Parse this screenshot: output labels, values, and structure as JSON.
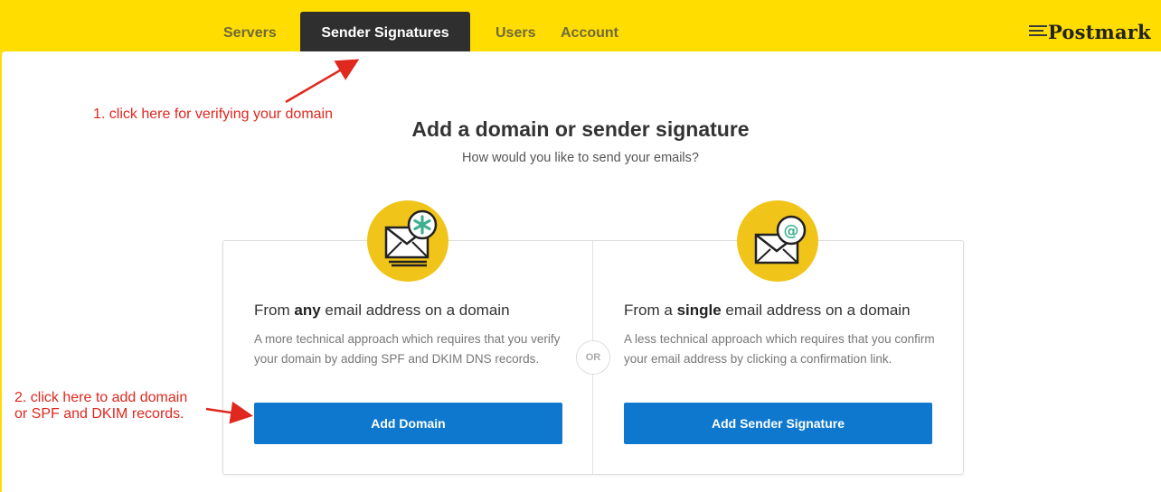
{
  "nav": {
    "items": [
      "Servers",
      "Sender Signatures",
      "Users",
      "Account"
    ],
    "active": "Sender Signatures"
  },
  "logo": "Postmark",
  "annotations": {
    "step1": "1. click here for verifying your domain",
    "step2_line1": "2. click here to add domain",
    "step2_line2": "or SPF and DKIM records."
  },
  "main": {
    "title": "Add a domain or sender signature",
    "subtitle": "How would you like to send your emails?",
    "or_label": "OR",
    "options": [
      {
        "title_prefix": "From ",
        "title_emphasis": "any",
        "title_suffix": " email address on a domain",
        "description": "A more technical approach which requires that you verify your domain by adding SPF and DKIM DNS records.",
        "button": "Add Domain",
        "icon": "envelope-asterisk-icon"
      },
      {
        "title_prefix": "From a ",
        "title_emphasis": "single",
        "title_suffix": " email address on a domain",
        "description": "A less technical approach which requires that you confirm your email address by clicking a confirmation link.",
        "button": "Add Sender Signature",
        "icon": "envelope-at-icon"
      }
    ]
  },
  "colors": {
    "brand_yellow": "#ffdd00",
    "nav_active_bg": "#2f2f2f",
    "button_blue": "#0e78cf",
    "icon_circle": "#f0c419",
    "annotation_red": "#e0281f",
    "badge_green": "#3fb08f"
  }
}
